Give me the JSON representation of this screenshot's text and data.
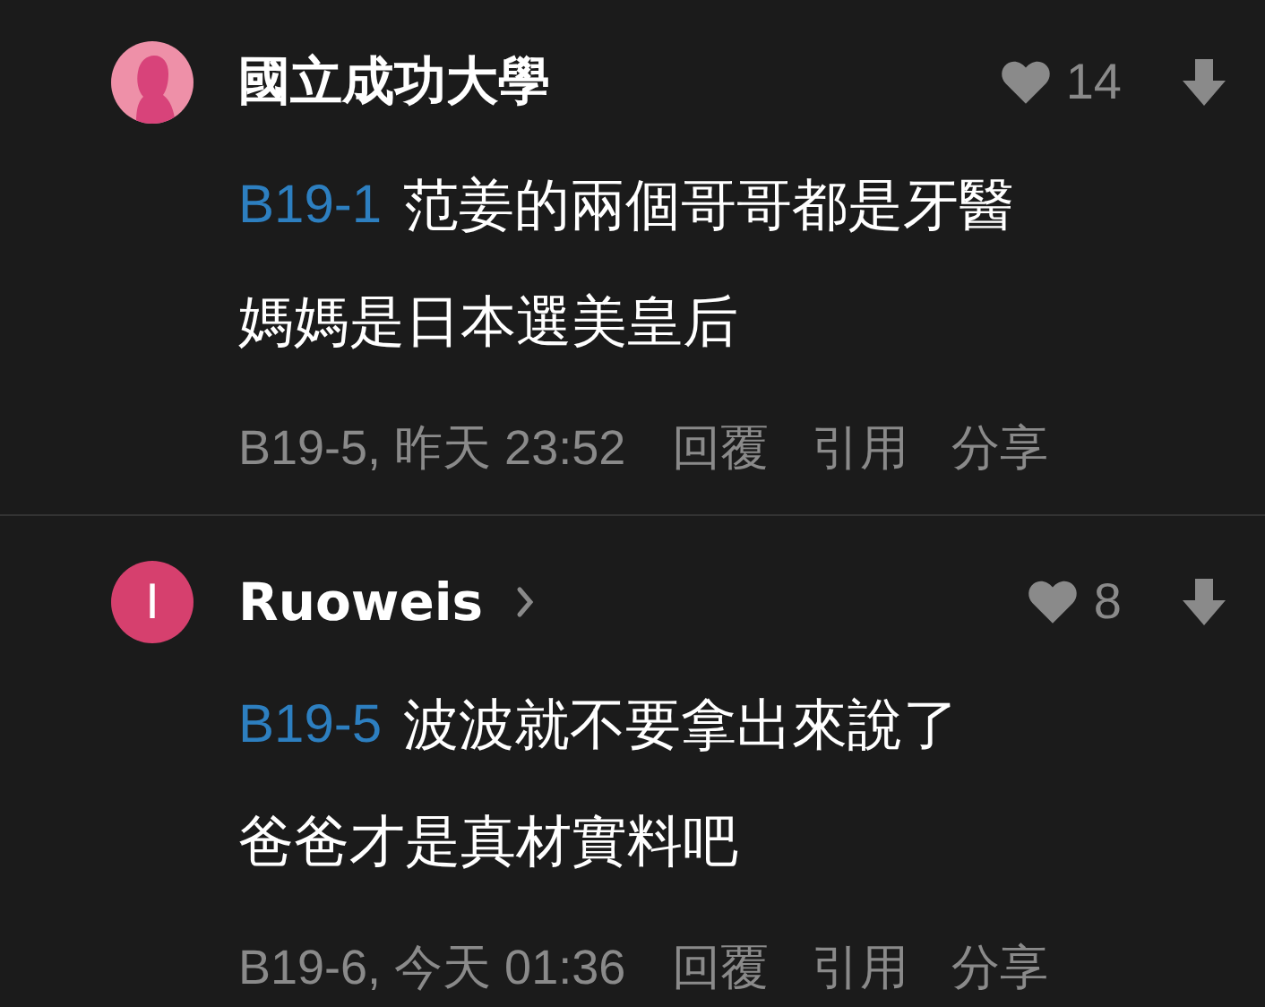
{
  "comments": [
    {
      "avatar": {
        "kind": "silhouette",
        "color": "#ee90a8"
      },
      "author": "國立成功大學",
      "profile_arrow": false,
      "likes": "14",
      "reply_to": "B19-1",
      "lines": [
        "范姜的兩個哥哥都是牙醫",
        "媽媽是日本選美皇后"
      ],
      "meta": "B19-5, 昨天 23:52",
      "actions": [
        "回覆",
        "引用",
        "分享"
      ]
    },
    {
      "avatar": {
        "kind": "initial",
        "color": "#d6406e",
        "letter": "I"
      },
      "author": "Ruoweis",
      "profile_arrow": true,
      "likes": "8",
      "reply_to": "B19-5",
      "lines": [
        "波波就不要拿出來說了",
        "爸爸才是真材實料吧"
      ],
      "meta": "B19-6, 今天 01:36",
      "actions": [
        "回覆",
        "引用",
        "分享"
      ]
    }
  ]
}
